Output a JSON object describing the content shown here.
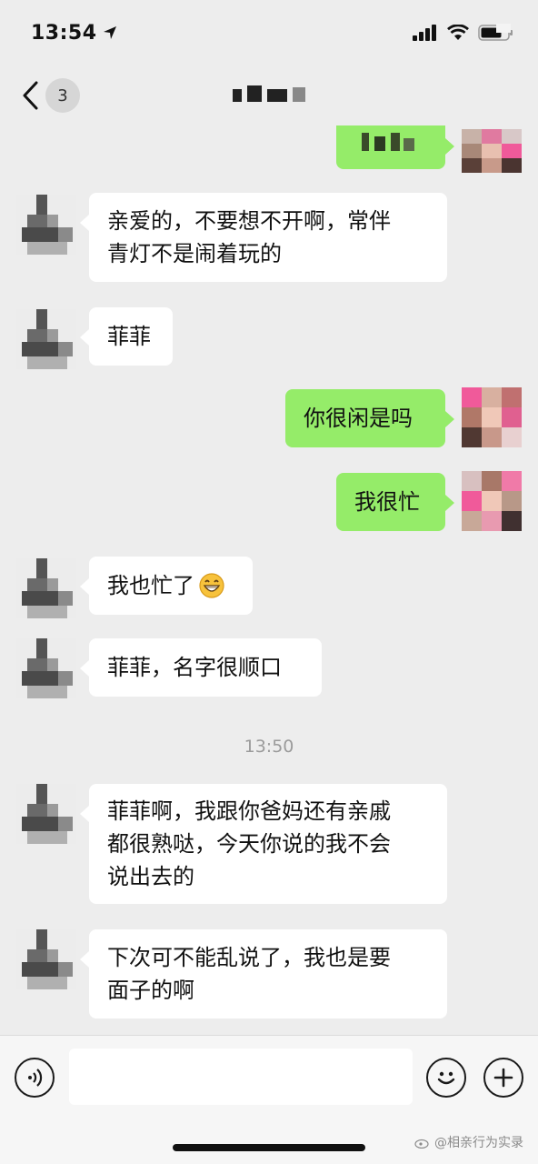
{
  "status_bar": {
    "time": "13:54"
  },
  "nav": {
    "unread_count": "3"
  },
  "messages": [
    {
      "side": "self",
      "text": ""
    },
    {
      "side": "other",
      "lines": [
        "亲爱的，不要想不开啊，常伴",
        "青灯不是闹着玩的"
      ]
    },
    {
      "side": "other",
      "lines": [
        "菲菲"
      ]
    },
    {
      "side": "self",
      "lines": [
        "你很闲是吗"
      ]
    },
    {
      "side": "self",
      "lines": [
        "我很忙"
      ]
    },
    {
      "side": "other",
      "lines": [
        "我也忙了"
      ],
      "emoji": "grin-emoji"
    },
    {
      "side": "other",
      "lines": [
        "菲菲，名字很顺口"
      ]
    },
    {
      "side": "other",
      "lines": [
        "菲菲啊，我跟你爸妈还有亲戚",
        "都很熟哒，今天你说的我不会",
        "说出去的"
      ]
    },
    {
      "side": "other",
      "lines": [
        "下次可不能乱说了，我也是要",
        "面子的啊"
      ]
    }
  ],
  "timestamp": "13:50",
  "input": {
    "placeholder": ""
  },
  "watermark": "@相亲行为实录",
  "colors": {
    "background": "#ededed",
    "self_bubble": "#95ec69",
    "other_bubble": "#ffffff"
  },
  "icons": [
    "location-arrow-icon",
    "signal-icon",
    "wifi-icon",
    "battery-icon",
    "back-chevron-icon",
    "voice-icon",
    "emoji-icon",
    "add-icon"
  ]
}
